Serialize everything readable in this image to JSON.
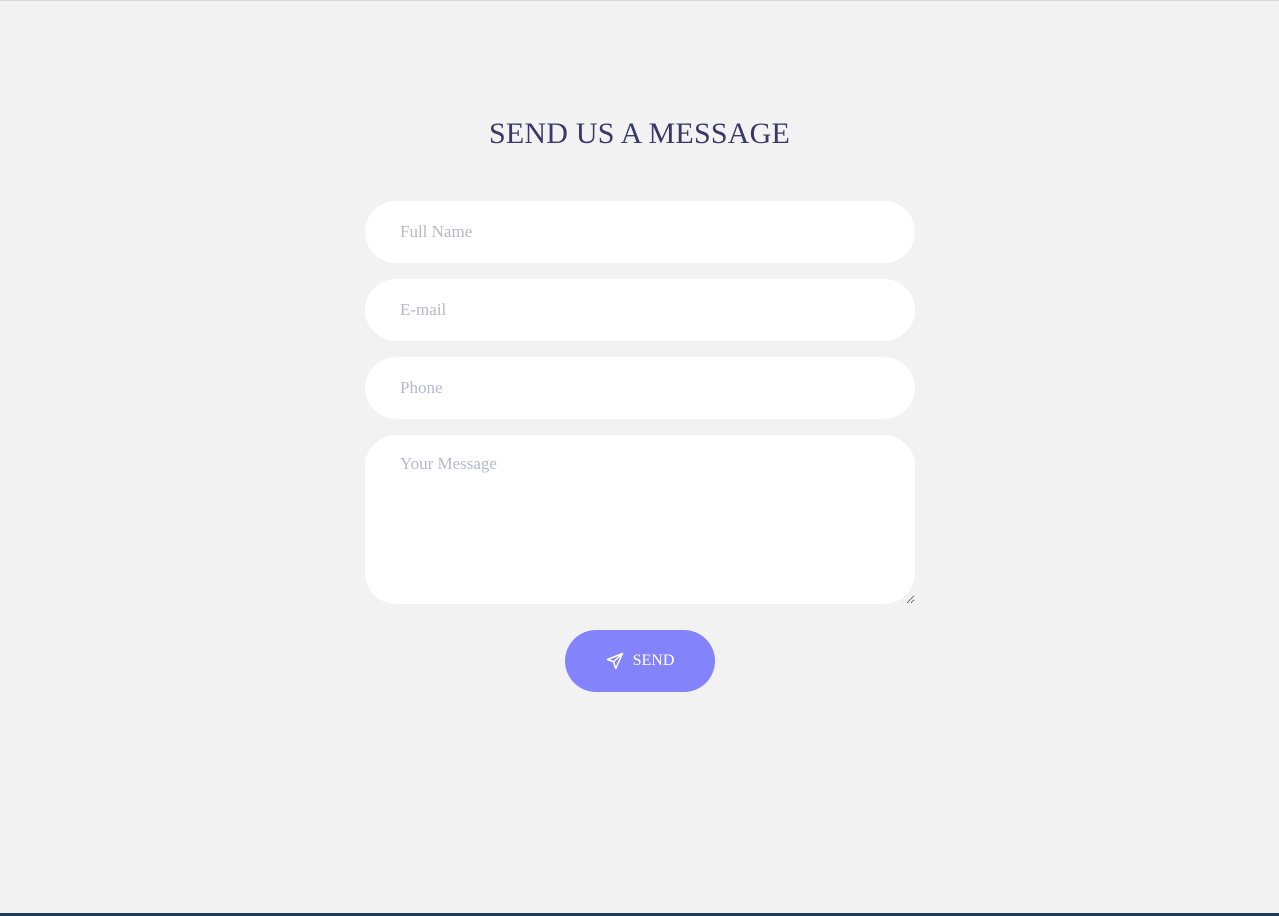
{
  "form": {
    "title": "SEND US A MESSAGE",
    "fields": {
      "full_name": {
        "placeholder": "Full Name",
        "value": ""
      },
      "email": {
        "placeholder": "E-mail",
        "value": ""
      },
      "phone": {
        "placeholder": "Phone",
        "value": ""
      },
      "message": {
        "placeholder": "Your Message",
        "value": ""
      }
    },
    "send_button": {
      "label": "SEND",
      "icon": "paper-plane-icon"
    }
  },
  "colors": {
    "background": "#f2f2f2",
    "title": "#3a3868",
    "field_background": "#ffffff",
    "placeholder": "#b8b7cc",
    "button": "#8383fb",
    "button_text": "#ffffff"
  }
}
